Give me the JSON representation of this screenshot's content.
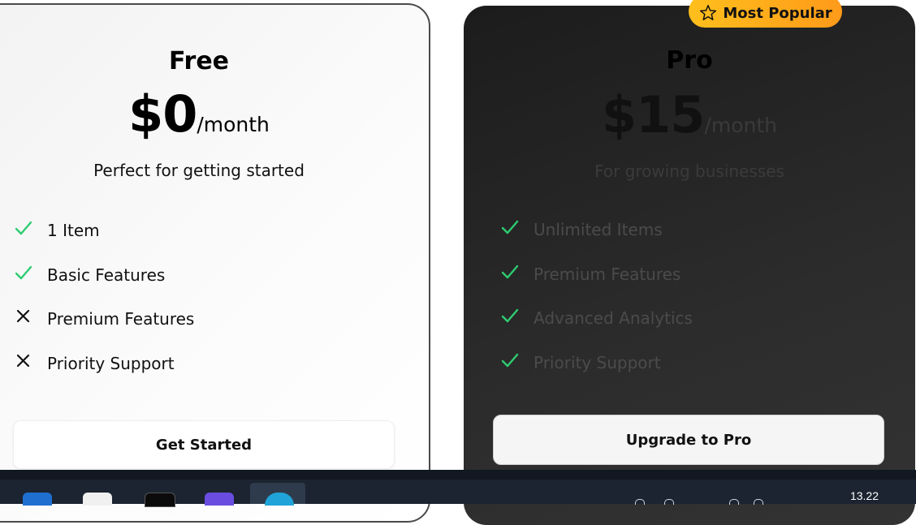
{
  "plans": {
    "free": {
      "name": "Free",
      "price": "$0",
      "period": "/month",
      "tagline": "Perfect for getting started",
      "features": [
        {
          "label": "1 Item",
          "included": true
        },
        {
          "label": "Basic Features",
          "included": true
        },
        {
          "label": "Premium Features",
          "included": false
        },
        {
          "label": "Priority Support",
          "included": false
        }
      ],
      "button": "Get Started"
    },
    "pro": {
      "badge": "Most Popular",
      "name": "Pro",
      "price": "$15",
      "period": "/month",
      "tagline": "For growing businesses",
      "features": [
        {
          "label": "Unlimited Items",
          "included": true
        },
        {
          "label": "Premium Features",
          "included": true
        },
        {
          "label": "Advanced Analytics",
          "included": true
        },
        {
          "label": "Priority Support",
          "included": true
        }
      ],
      "button": "Upgrade to Pro"
    }
  },
  "taskbar": {
    "clock": "13.22"
  },
  "colors": {
    "check": "#2ecc71",
    "cross": "#111111",
    "badge_start": "#ffbf1c",
    "badge_end": "#ff9a1a",
    "pro_card": "#262626"
  },
  "icons": {
    "included": "check-icon",
    "excluded": "close-icon",
    "badge": "star-icon"
  }
}
